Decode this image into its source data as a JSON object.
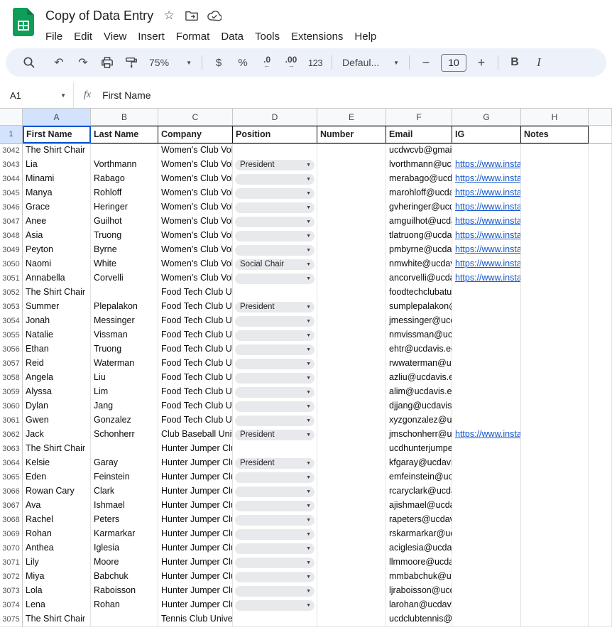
{
  "app": {
    "title": "Copy of Data Entry",
    "menus": [
      "File",
      "Edit",
      "View",
      "Insert",
      "Format",
      "Data",
      "Tools",
      "Extensions",
      "Help"
    ]
  },
  "icons": {
    "undo": "↶",
    "redo": "↷",
    "dropdown": "▼",
    "arrow_left": "←",
    "arrow_right": "→",
    "star": "☆"
  },
  "toolbar": {
    "zoom": "75%",
    "currency": "$",
    "percent": "%",
    "decrease_decimal": ".0",
    "increase_decimal": ".00",
    "more_formats": "123",
    "font": "Defaul...",
    "font_size": "10",
    "minus": "−",
    "plus": "+",
    "bold": "B",
    "italic": "I"
  },
  "formula_bar": {
    "cell_ref": "A1",
    "fx": "fx",
    "value": "First Name"
  },
  "sheet": {
    "column_letters": [
      "A",
      "B",
      "C",
      "D",
      "E",
      "F",
      "G",
      "H"
    ],
    "selected_column": "A",
    "header_row": {
      "n": "1",
      "cells": [
        "First Name",
        "Last Name",
        "Company",
        "Position",
        "Number",
        "Email",
        "IG",
        "Notes"
      ]
    },
    "rows": [
      {
        "n": "3042",
        "first": "The Shirt Chair",
        "last": "",
        "company": "Women's Club Voll",
        "position": null,
        "email": "ucdwcvb@gmail",
        "ig": ""
      },
      {
        "n": "3043",
        "first": "Lia",
        "last": "Vorthmann",
        "company": "Women's Club Voll",
        "position": "President",
        "email": "lvorthmann@ucd",
        "ig": "https://www.insta"
      },
      {
        "n": "3044",
        "first": "Minami",
        "last": "Rabago",
        "company": "Women's Club Voll",
        "position": "",
        "email": "merabago@ucda",
        "ig": "https://www.insta"
      },
      {
        "n": "3045",
        "first": "Manya",
        "last": "Rohloff",
        "company": "Women's Club Voll",
        "position": "",
        "email": "marohloff@ucda",
        "ig": "https://www.insta"
      },
      {
        "n": "3046",
        "first": "Grace",
        "last": "Heringer",
        "company": "Women's Club Voll",
        "position": "",
        "email": "gvheringer@ucd",
        "ig": "https://www.insta"
      },
      {
        "n": "3047",
        "first": "Anee",
        "last": "Guilhot",
        "company": "Women's Club Voll",
        "position": "",
        "email": "amguilhot@ucda",
        "ig": "https://www.insta"
      },
      {
        "n": "3048",
        "first": "Asia",
        "last": "Truong",
        "company": "Women's Club Voll",
        "position": "",
        "email": "tlatruong@ucdav",
        "ig": "https://www.insta"
      },
      {
        "n": "3049",
        "first": "Peyton",
        "last": "Byrne",
        "company": "Women's Club Voll",
        "position": "",
        "email": "pmbyrne@ucdav",
        "ig": "https://www.insta"
      },
      {
        "n": "3050",
        "first": "Naomi",
        "last": "White",
        "company": "Women's Club Voll",
        "position": "Social Chair",
        "email": "nmwhite@ucdav",
        "ig": "https://www.insta"
      },
      {
        "n": "3051",
        "first": "Annabella",
        "last": "Corvelli",
        "company": "Women's Club Voll",
        "position": "",
        "email": "ancorvelli@ucda",
        "ig": "https://www.insta"
      },
      {
        "n": "3052",
        "first": "The Shirt Chair",
        "last": "",
        "company": "Food Tech Club Ur",
        "position": null,
        "email": "foodtechclubatuc",
        "ig": ""
      },
      {
        "n": "3053",
        "first": "Summer",
        "last": "Plepalakon",
        "company": "Food Tech Club Ur",
        "position": "President",
        "email": "sumplepalakon@",
        "ig": ""
      },
      {
        "n": "3054",
        "first": "Jonah",
        "last": "Messinger",
        "company": "Food Tech Club Ur",
        "position": "",
        "email": "jmessinger@ucd",
        "ig": ""
      },
      {
        "n": "3055",
        "first": "Natalie",
        "last": "Vissman",
        "company": "Food Tech Club Ur",
        "position": "",
        "email": "nmvissman@ucd",
        "ig": ""
      },
      {
        "n": "3056",
        "first": "Ethan",
        "last": "Truong",
        "company": "Food Tech Club Ur",
        "position": "",
        "email": "ehtr@ucdavis.ed",
        "ig": ""
      },
      {
        "n": "3057",
        "first": "Reid",
        "last": "Waterman",
        "company": "Food Tech Club Ur",
        "position": "",
        "email": "rwwaterman@uc",
        "ig": ""
      },
      {
        "n": "3058",
        "first": "Angela",
        "last": "Liu",
        "company": "Food Tech Club Ur",
        "position": "",
        "email": "azliu@ucdavis.e",
        "ig": ""
      },
      {
        "n": "3059",
        "first": "Alyssa",
        "last": "Lim",
        "company": "Food Tech Club Ur",
        "position": "",
        "email": "alim@ucdavis.ed",
        "ig": ""
      },
      {
        "n": "3060",
        "first": "Dylan",
        "last": "Jang",
        "company": "Food Tech Club Ur",
        "position": "",
        "email": "djjang@ucdavis.",
        "ig": ""
      },
      {
        "n": "3061",
        "first": "Gwen",
        "last": "Gonzalez",
        "company": "Food Tech Club Ur",
        "position": "",
        "email": "xyzgonzalez@uc",
        "ig": ""
      },
      {
        "n": "3062",
        "first": "Jack",
        "last": "Schonherr",
        "company": "Club Baseball Univ",
        "position": "President",
        "email": "jmschonherr@uc",
        "ig": "https://www.insta"
      },
      {
        "n": "3063",
        "first": "The Shirt Chair",
        "last": "",
        "company": "Hunter Jumper Clu",
        "position": null,
        "email": "ucdhunterjumper",
        "ig": ""
      },
      {
        "n": "3064",
        "first": "Kelsie",
        "last": "Garay",
        "company": "Hunter Jumper Clu",
        "position": "President",
        "email": "kfgaray@ucdavis",
        "ig": ""
      },
      {
        "n": "3065",
        "first": "Eden",
        "last": "Feinstein",
        "company": "Hunter Jumper Clu",
        "position": "",
        "email": "emfeinstein@uc",
        "ig": ""
      },
      {
        "n": "3066",
        "first": "Rowan Cary",
        "last": "Clark",
        "company": "Hunter Jumper Clu",
        "position": "",
        "email": "rcaryclark@ucda",
        "ig": ""
      },
      {
        "n": "3067",
        "first": "Ava",
        "last": "Ishmael",
        "company": "Hunter Jumper Clu",
        "position": "",
        "email": "ajishmael@ucda",
        "ig": ""
      },
      {
        "n": "3068",
        "first": "Rachel",
        "last": "Peters",
        "company": "Hunter Jumper Clu",
        "position": "",
        "email": "rapeters@ucdav",
        "ig": ""
      },
      {
        "n": "3069",
        "first": "Rohan",
        "last": "Karmarkar",
        "company": "Hunter Jumper Clu",
        "position": "",
        "email": "rskarmarkar@uc",
        "ig": ""
      },
      {
        "n": "3070",
        "first": "Anthea",
        "last": "Iglesia",
        "company": "Hunter Jumper Clu",
        "position": "",
        "email": "aciglesia@ucdav",
        "ig": ""
      },
      {
        "n": "3071",
        "first": "Lily",
        "last": "Moore",
        "company": "Hunter Jumper Clu",
        "position": "",
        "email": "llmmoore@ucda",
        "ig": ""
      },
      {
        "n": "3072",
        "first": "Miya",
        "last": "Babchuk",
        "company": "Hunter Jumper Clu",
        "position": "",
        "email": "mmbabchuk@uc",
        "ig": ""
      },
      {
        "n": "3073",
        "first": "Lola",
        "last": "Raboisson",
        "company": "Hunter Jumper Clu",
        "position": "",
        "email": "ljraboisson@ucd",
        "ig": ""
      },
      {
        "n": "3074",
        "first": "Lena",
        "last": "Rohan",
        "company": "Hunter Jumper Clu",
        "position": "",
        "email": "larohan@ucdavis",
        "ig": ""
      },
      {
        "n": "3075",
        "first": "The Shirt Chair",
        "last": "",
        "company": "Tennis Club Unive",
        "position": null,
        "email": "ucdclubtennis@g",
        "ig": ""
      }
    ]
  },
  "colors": {
    "accent": "#0b57d0",
    "link": "#1155cc",
    "logo_green": "#0f9d58",
    "toolbar_bg": "#edf2fa",
    "selected_header_bg": "#d3e3fd"
  }
}
